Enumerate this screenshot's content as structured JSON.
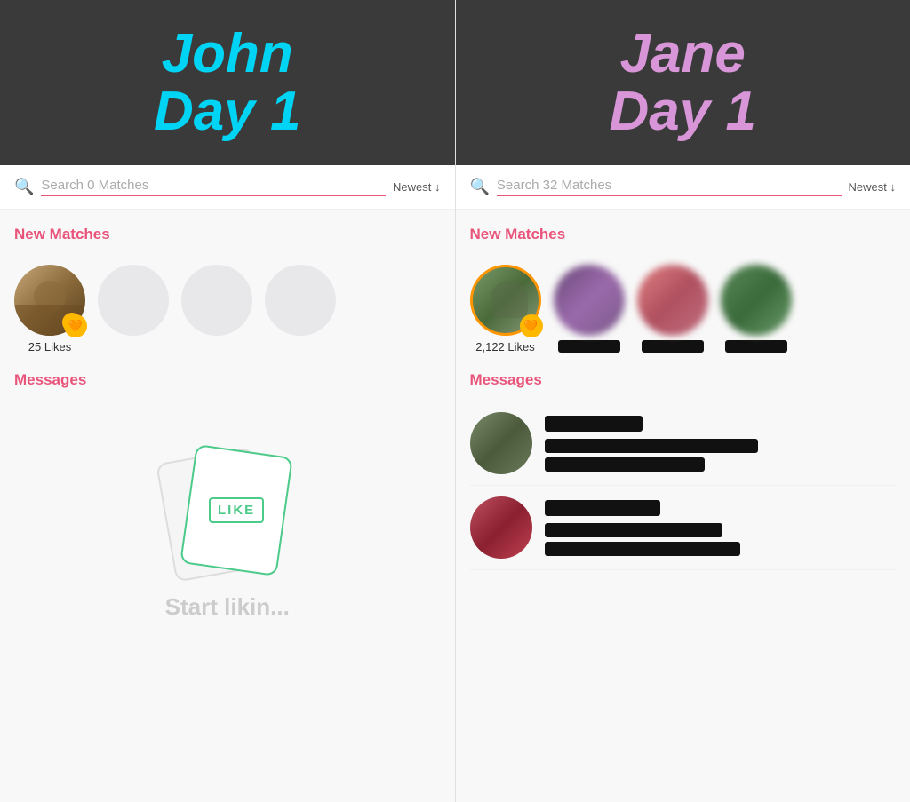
{
  "left": {
    "header": {
      "line1": "John",
      "line2": "Day 1",
      "color_class": "john"
    },
    "search": {
      "placeholder": "Search 0 Matches",
      "sort": "Newest ↓"
    },
    "new_matches_title": "New Matches",
    "likes_label": "25 Likes",
    "messages_title": "Messages",
    "start_hint": "Start likin..."
  },
  "right": {
    "header": {
      "line1": "Jane",
      "line2": "Day 1",
      "color_class": "jane"
    },
    "search": {
      "placeholder": "Search 32 Matches",
      "sort": "Newest ↓"
    },
    "new_matches_title": "New Matches",
    "likes_label": "2,122 Likes",
    "messages_title": "Messages"
  },
  "icons": {
    "search": "🔍",
    "heart": "♥",
    "like_stamp": "LIKE"
  }
}
